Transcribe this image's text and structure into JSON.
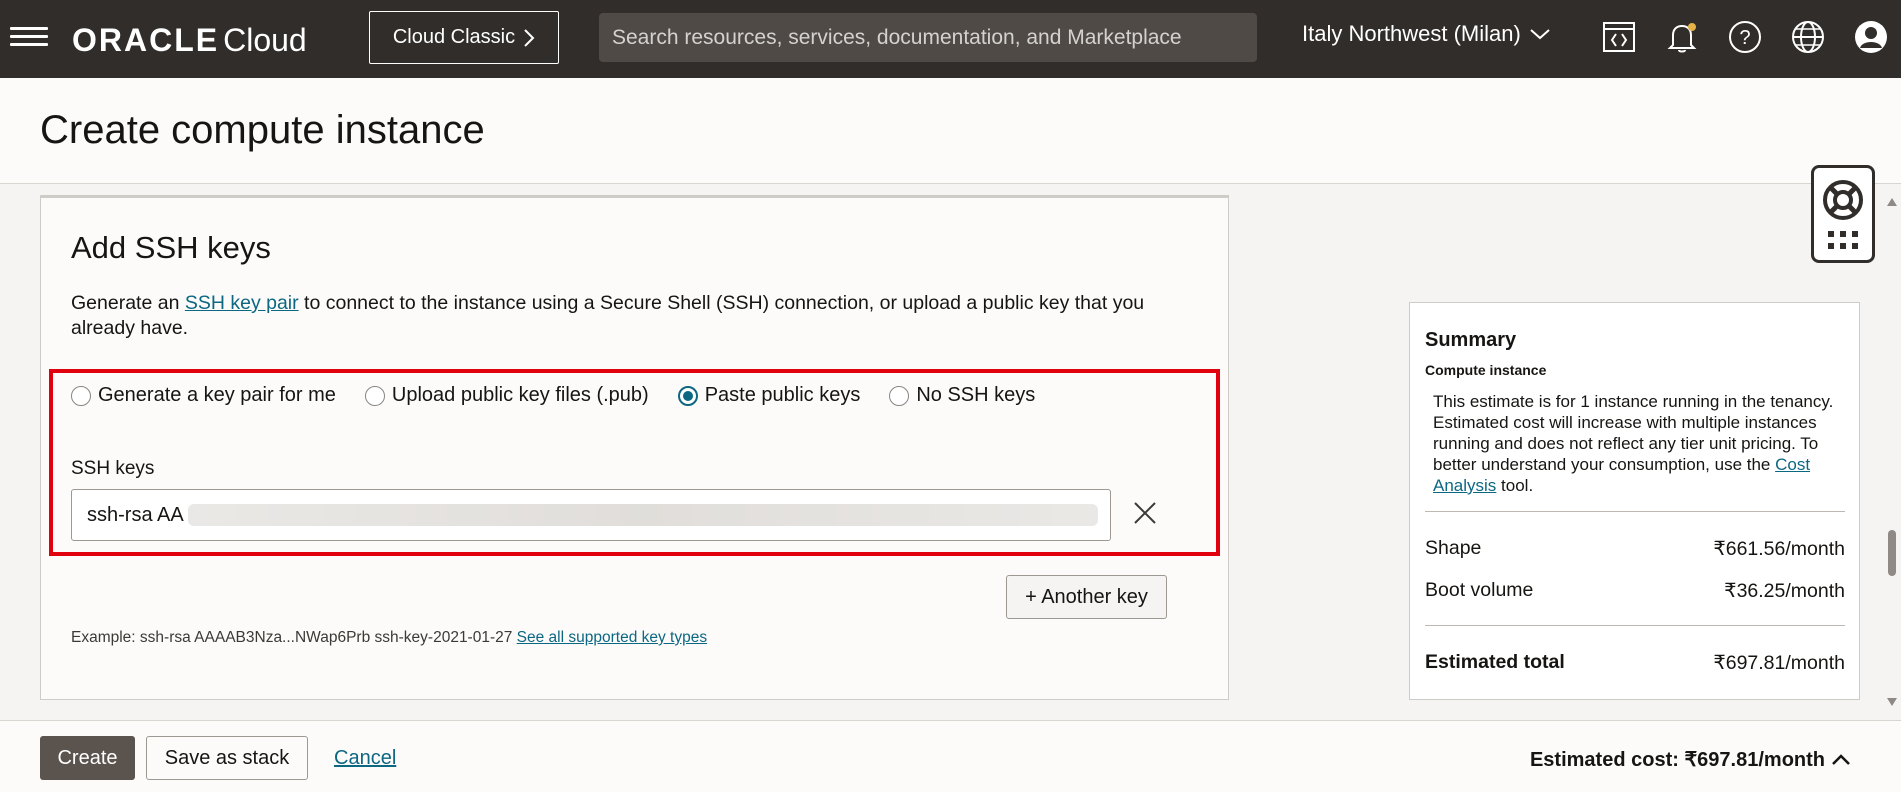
{
  "header": {
    "brand": "ORACLE",
    "brand_sub": "Cloud",
    "classic_label": "Cloud Classic",
    "search_placeholder": "Search resources, services, documentation, and Marketplace",
    "region": "Italy Northwest (Milan)"
  },
  "page": {
    "title": "Create compute instance"
  },
  "ssh": {
    "title": "Add SSH keys",
    "desc_prefix": "Generate an ",
    "desc_link": "SSH key pair",
    "desc_suffix": " to connect to the instance using a Secure Shell (SSH) connection, or upload a public key that you already have.",
    "options": [
      {
        "label": "Generate a key pair for me",
        "selected": false
      },
      {
        "label": "Upload public key files (.pub)",
        "selected": false
      },
      {
        "label": "Paste public keys",
        "selected": true
      },
      {
        "label": "No SSH keys",
        "selected": false
      }
    ],
    "keys_label": "SSH keys",
    "keys_value": "ssh-rsa AA",
    "another_key_label": "+ Another key",
    "example_text": "Example: ssh-rsa AAAAB3Nza...NWap6Prb ssh-key-2021-01-27 ",
    "example_link": "See all supported key types"
  },
  "summary": {
    "title": "Summary",
    "subtitle": "Compute instance",
    "note_prefix": "This estimate is for 1 instance running in the tenancy. Estimated cost will increase with multiple instances running and does not reflect any tier unit pricing. To better understand your consumption, use the ",
    "note_link": "Cost Analysis",
    "note_suffix": " tool.",
    "rows": [
      {
        "label": "Shape",
        "value": "₹661.56/month"
      },
      {
        "label": "Boot volume",
        "value": "₹36.25/month"
      }
    ],
    "total_label": "Estimated total",
    "total_value": "₹697.81/month"
  },
  "footer": {
    "create_label": "Create",
    "save_stack_label": "Save as stack",
    "cancel_label": "Cancel",
    "estimated_cost": "Estimated cost: ₹697.81/month"
  },
  "colors": {
    "header_bg": "#312d2a",
    "link": "#0c6782",
    "highlight": "#e0000e",
    "primary_button": "#5a534e"
  }
}
